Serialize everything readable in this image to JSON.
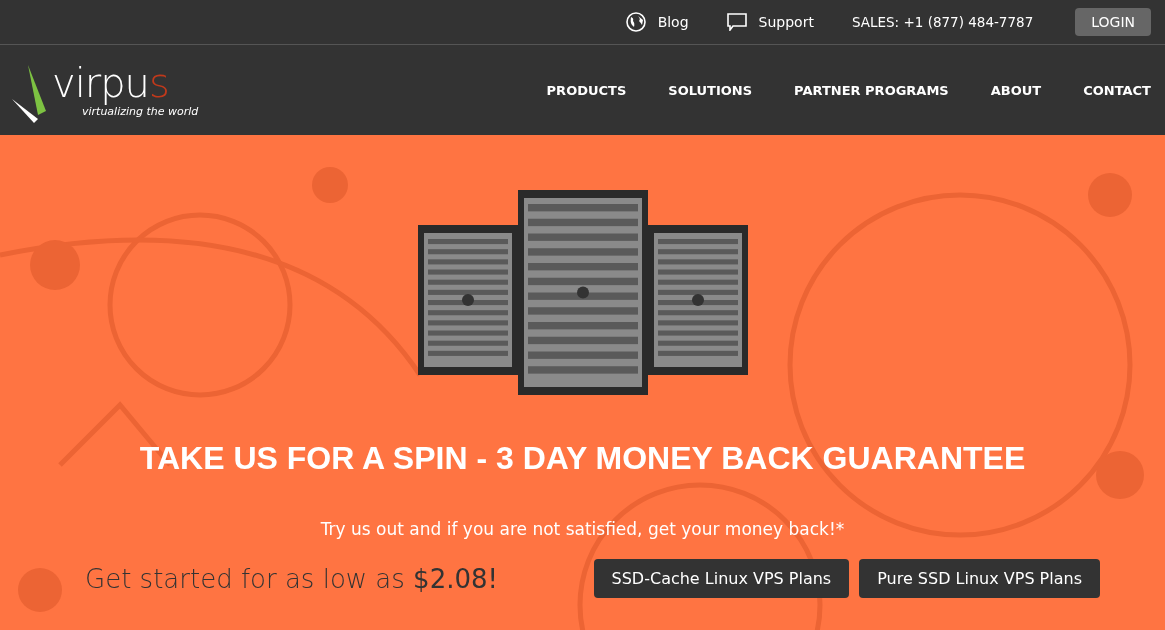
{
  "topbar": {
    "links": [
      {
        "kind": "globe",
        "label": "Blog"
      },
      {
        "kind": "chat",
        "label": "Support"
      }
    ],
    "sales": "SALES: +1 (877) 484-7787",
    "login": "LOGIN"
  },
  "logo": {
    "wordmark": "virpu",
    "accent": "s",
    "tagline": "virtualizing the world"
  },
  "nav": [
    "PRODUCTS",
    "SOLUTIONS",
    "PARTNER PROGRAMS",
    "ABOUT",
    "CONTACT"
  ],
  "hero": {
    "headline": "TAKE US FOR A SPIN - 3 DAY MONEY BACK GUARANTEE",
    "subline": "Try us out and if you are not satisfied, get your money back!*",
    "offer": "Get started for as low as **$2.08!**",
    "buttons": [
      "SSD-Cache Linux VPS Plans",
      "Pure SSD Linux VPS Plans"
    ]
  }
}
